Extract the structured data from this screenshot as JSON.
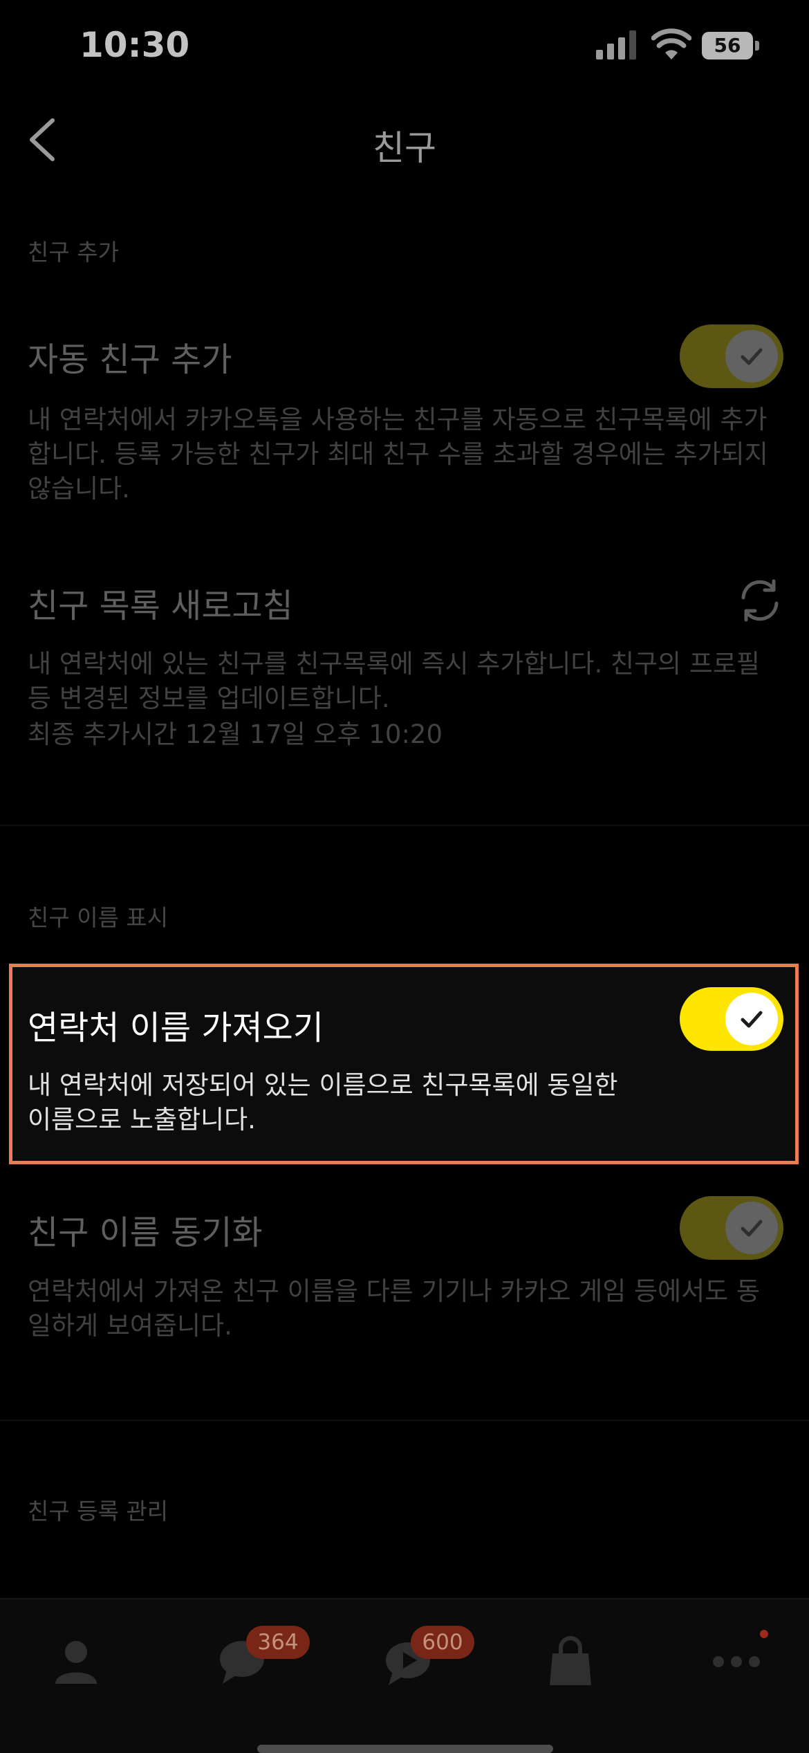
{
  "status_bar": {
    "time": "10:30",
    "battery": "56"
  },
  "nav": {
    "title": "친구"
  },
  "sections": {
    "add": {
      "header": "친구 추가"
    },
    "display": {
      "header": "친구 이름 표시"
    },
    "manage": {
      "header": "친구 등록 관리"
    }
  },
  "items": {
    "auto_add": {
      "title": "자동 친구 추가",
      "desc": "내 연락처에서 카카오톡을 사용하는 친구를 자동으로 친구목록에 추가합니다. 등록 가능한 친구가 최대 친구 수를 초과할 경우에는 추가되지 않습니다.",
      "enabled": true
    },
    "refresh": {
      "title": "친구 목록 새로고침",
      "desc": "내 연락처에 있는 친구를 친구목록에 즉시 추가합니다. 친구의 프로필 등 변경된 정보를 업데이트합니다.",
      "last_added": "최종 추가시간 12월 17일 오후 10:20"
    },
    "import_names": {
      "title": "연락처 이름 가져오기",
      "desc_line1": "내 연락처에 저장되어 있는 이름으로 친구목록에 동일한",
      "desc_line2": "이름으로 노출합니다.",
      "enabled": true
    },
    "sync_names": {
      "title": "친구 이름 동기화",
      "desc": "연락처에서 가져온 친구 이름을 다른 기기나 카카오 게임 등에서도 동일하게 보여줍니다.",
      "enabled": true
    }
  },
  "tab_bar": {
    "chats_badge": "364",
    "openchat_badge": "600"
  },
  "colors": {
    "accent_yellow": "#fee500",
    "highlight_border": "#ee7c52",
    "badge_red": "#7a2616"
  }
}
